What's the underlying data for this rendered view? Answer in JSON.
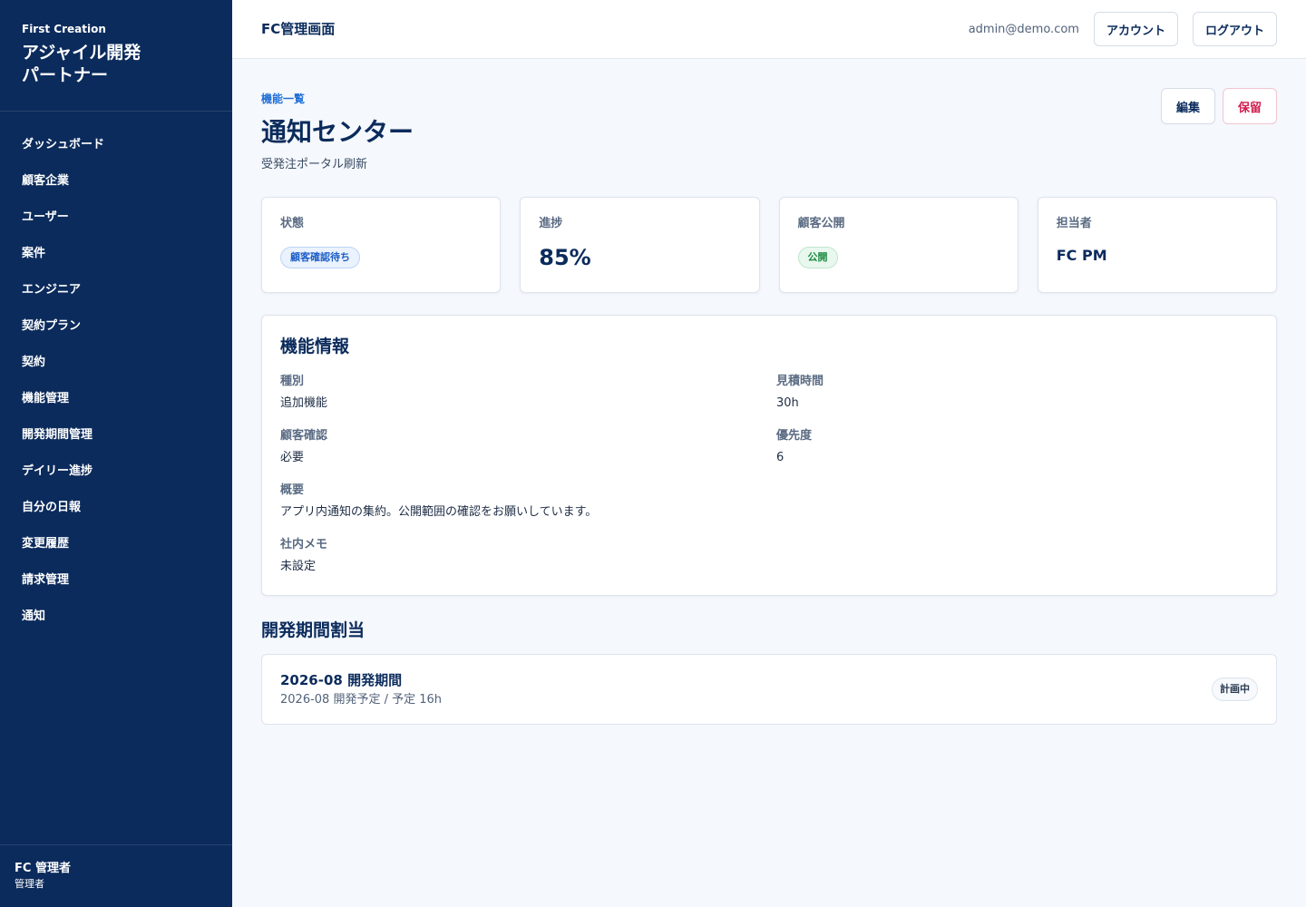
{
  "sidebar": {
    "brand_small": "First Creation",
    "brand_big": "アジャイル開発\nパートナー",
    "nav": [
      "ダッシュボード",
      "顧客企業",
      "ユーザー",
      "案件",
      "エンジニア",
      "契約プラン",
      "契約",
      "機能管理",
      "開発期間管理",
      "デイリー進捗",
      "自分の日報",
      "変更履歴",
      "請求管理",
      "通知"
    ],
    "user_name": "FC 管理者",
    "user_role": "管理者"
  },
  "topbar": {
    "title": "FC管理画面",
    "email": "admin@demo.com",
    "account_label": "アカウント",
    "logout_label": "ログアウト"
  },
  "page": {
    "breadcrumb": "機能一覧",
    "title": "通知センター",
    "subtitle": "受発注ポータル刷新",
    "edit_label": "編集",
    "hold_label": "保留"
  },
  "summary": {
    "status_label": "状態",
    "status_value": "顧客確認待ち",
    "progress_label": "進捗",
    "progress_value": "85%",
    "public_label": "顧客公開",
    "public_value": "公開",
    "owner_label": "担当者",
    "owner_value": "FC PM"
  },
  "info": {
    "title": "機能情報",
    "type_label": "種別",
    "type_value": "追加機能",
    "estimate_label": "見積時間",
    "estimate_value": "30h",
    "confirm_label": "顧客確認",
    "confirm_value": "必要",
    "priority_label": "優先度",
    "priority_value": "6",
    "overview_label": "概要",
    "overview_value": "アプリ内通知の集約。公開範囲の確認をお願いしています。",
    "memo_label": "社内メモ",
    "memo_value": "未設定"
  },
  "periods": {
    "title": "開発期間割当",
    "items": [
      {
        "name": "2026-08 開発期間",
        "meta": "2026-08 開発予定 / 予定 16h",
        "status": "計画中"
      }
    ]
  },
  "colors": {
    "sidebar_bg": "#0b2b5c",
    "accent": "#1f6fd6",
    "danger": "#d11e4f",
    "success": "#1a8a3f"
  }
}
